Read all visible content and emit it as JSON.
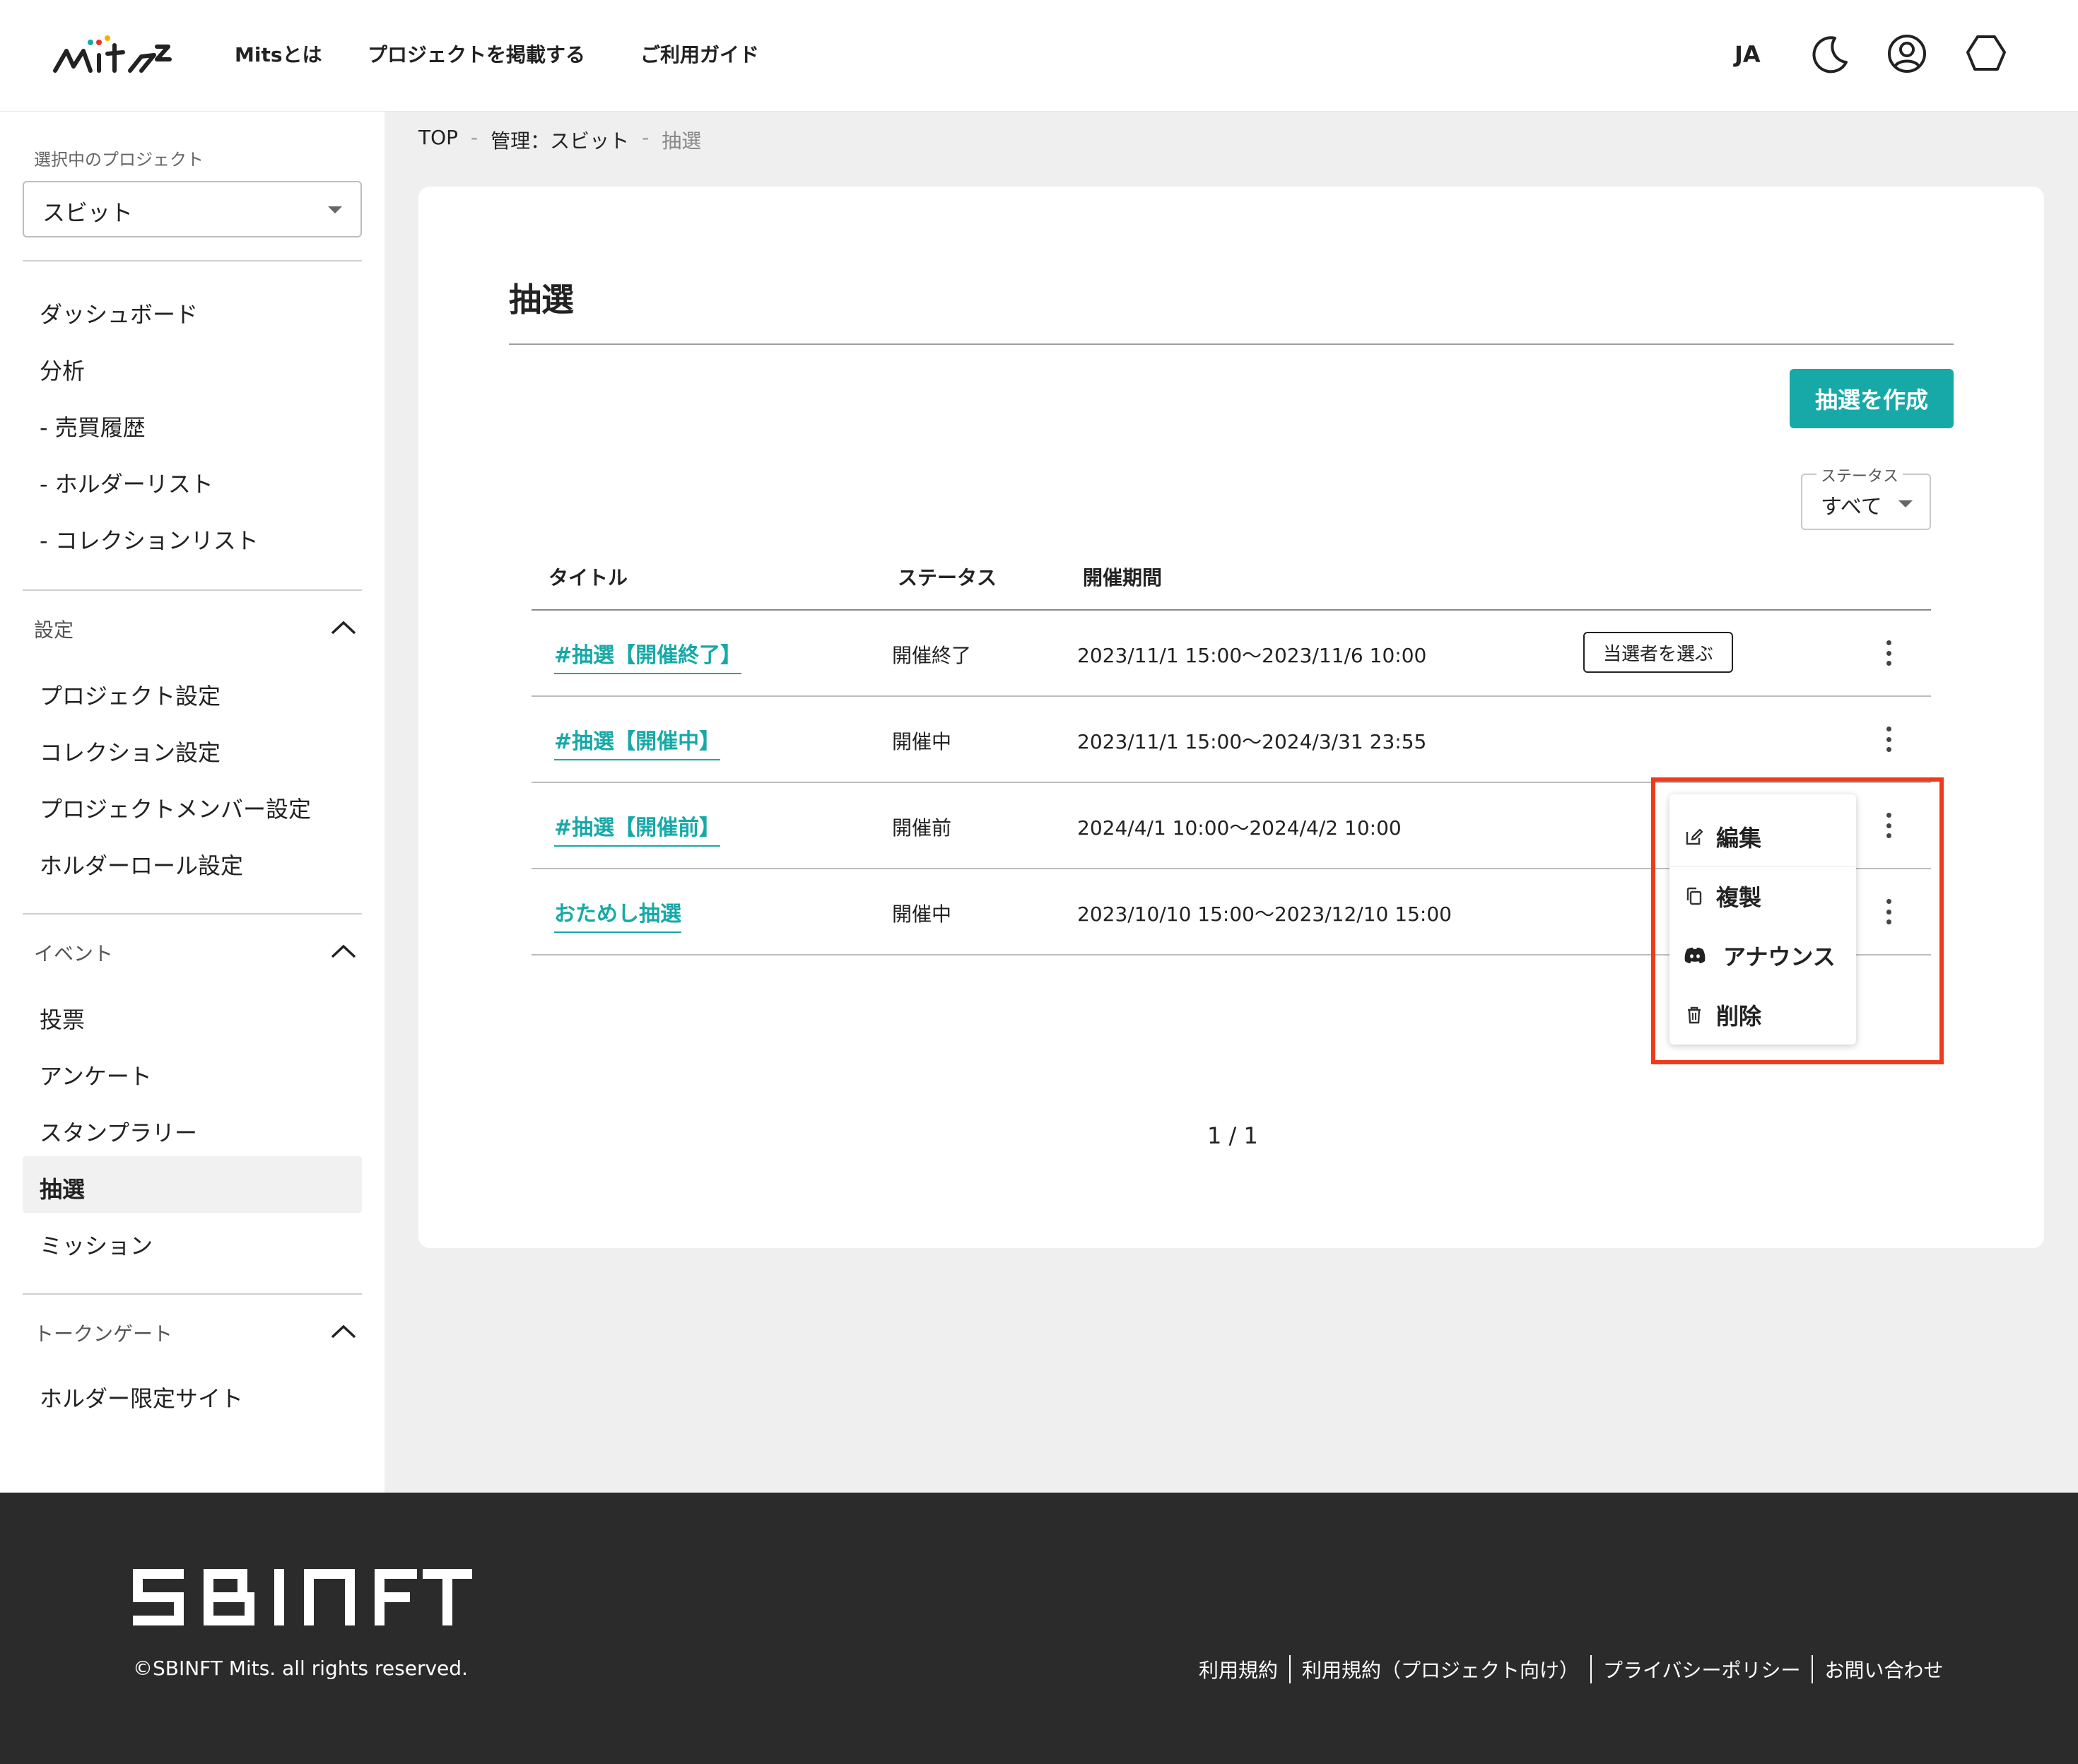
{
  "header": {
    "logo_text": "mits",
    "nav": [
      "Mitsとは",
      "プロジェクトを掲載する",
      "ご利用ガイド"
    ],
    "lang": "JA",
    "icons": [
      "moon-icon",
      "account-icon",
      "wallet-icon"
    ]
  },
  "sidebar": {
    "project_caption": "選択中のプロジェクト",
    "project_value": "スビット",
    "main_items": [
      "ダッシュボード",
      "分析",
      "- 売買履歴",
      "- ホルダーリスト",
      "- コレクションリスト"
    ],
    "settings": {
      "title": "設定",
      "items": [
        "プロジェクト設定",
        "コレクション設定",
        "プロジェクトメンバー設定",
        "ホルダーロール設定"
      ]
    },
    "events": {
      "title": "イベント",
      "items": [
        "投票",
        "アンケート",
        "スタンプラリー",
        "抽選",
        "ミッション"
      ],
      "active": "抽選"
    },
    "token_gate": {
      "title": "トークンゲート",
      "items": [
        "ホルダー限定サイト"
      ]
    }
  },
  "breadcrumb": [
    "TOP",
    "管理：スビット",
    "抽選"
  ],
  "page": {
    "title": "抽選",
    "create_button": "抽選を作成",
    "status_filter": {
      "label": "ステータス",
      "value": "すべて"
    },
    "columns": [
      "タイトル",
      "ステータス",
      "開催期間"
    ],
    "rows": [
      {
        "title": "#抽選【開催終了】",
        "status": "開催終了",
        "period": "2023/11/1 15:00〜2023/11/6 10:00",
        "action": "当選者を選ぶ"
      },
      {
        "title": "#抽選【開催中】",
        "status": "開催中",
        "period": "2023/11/1 15:00〜2024/3/31 23:55"
      },
      {
        "title": "#抽選【開催前】",
        "status": "開催前",
        "period": "2024/4/1 10:00〜2024/4/2 10:00"
      },
      {
        "title": "おためし抽選",
        "status": "開催中",
        "period": "2023/10/10 15:00〜2023/12/10 15:00"
      }
    ],
    "menu": [
      "編集",
      "複製",
      "アナウンス",
      "削除"
    ],
    "pager": "1 / 1"
  },
  "footer": {
    "logo_text": "SBINFT",
    "copyright": "©SBINFT Mits. all rights reserved.",
    "links": [
      "利用規約",
      "利用規約（プロジェクト向け）",
      "プライバシーポリシー",
      "お問い合わせ"
    ]
  },
  "colors": {
    "accent": "#17a9a8",
    "highlight": "#f03a1e",
    "footer_bg": "#2b2b2b"
  }
}
